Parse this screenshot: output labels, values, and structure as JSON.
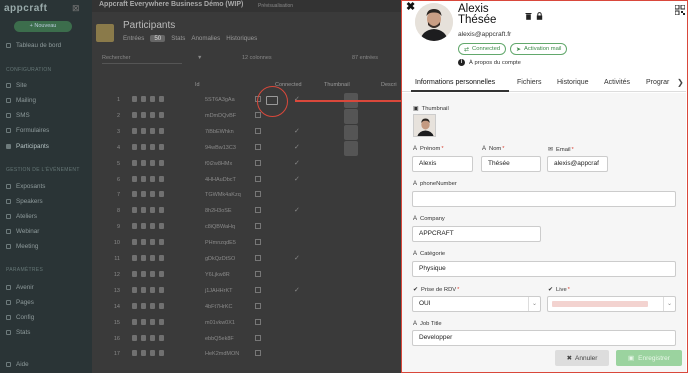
{
  "sidebar": {
    "logo": "appcraft",
    "new_button": "+ Nouveau",
    "groups": [
      "CONFIGURATION",
      "GESTION DE L'ÉVÉNEMENT",
      "PARAMÈTRES"
    ],
    "items": [
      "Tableau de bord",
      "Site",
      "Mailing",
      "SMS",
      "Formulaires",
      "Participants",
      "Exposants",
      "Speakers",
      "Ateliers",
      "Webinar",
      "Meeting",
      "Avenir",
      "Pages",
      "Config",
      "Stats",
      "Aide"
    ]
  },
  "main": {
    "app_title": "Appcraft Everywhere Business Démo (WIP)",
    "app_subtitle": "Event",
    "preview_label": "Prévisualisation",
    "page_title": "Participants",
    "tabs": [
      "Entrées",
      "Stats",
      "Anomalies",
      "Historiques"
    ],
    "entries_count": "50",
    "toolbar": {
      "search_placeholder": "Rechercher",
      "columns": "12 colonnes",
      "entries": "87 entrées"
    },
    "columns": [
      "Id",
      "Connected",
      "Thumbnail",
      "Descri"
    ],
    "rows": [
      {
        "num": "1",
        "code": "5ST6A3gAa",
        "connected": true,
        "thumb": true
      },
      {
        "num": "2",
        "code": "mDmDQvBF",
        "connected": false,
        "thumb": true
      },
      {
        "num": "3",
        "code": "7iBbEWhkn",
        "connected": true,
        "thumb": true
      },
      {
        "num": "4",
        "code": "94wBw13C3",
        "connected": true,
        "thumb": true
      },
      {
        "num": "5",
        "code": "f0i2w8HMx",
        "connected": true,
        "thumb": false
      },
      {
        "num": "6",
        "code": "4HHAuDbcT",
        "connected": true,
        "thumb": false
      },
      {
        "num": "7",
        "code": "TGWMk4aKzq",
        "connected": false,
        "thumb": false
      },
      {
        "num": "8",
        "code": "8h2H3oSE",
        "connected": true,
        "thumb": false
      },
      {
        "num": "9",
        "code": "c8iQBWaHq",
        "connected": false,
        "thumb": false
      },
      {
        "num": "10",
        "code": "PHmnzqdE5",
        "connected": false,
        "thumb": false
      },
      {
        "num": "11",
        "code": "gDkQzDtSO",
        "connected": true,
        "thumb": false
      },
      {
        "num": "12",
        "code": "Y6Ljkw8R",
        "connected": false,
        "thumb": false
      },
      {
        "num": "13",
        "code": "j1JAHHrKT",
        "connected": true,
        "thumb": false
      },
      {
        "num": "14",
        "code": "4bFt7HrKC",
        "connected": false,
        "thumb": false
      },
      {
        "num": "15",
        "code": "m01vkw0X1",
        "connected": false,
        "thumb": false
      },
      {
        "num": "16",
        "code": "ebbQ5ek8F",
        "connected": false,
        "thumb": false
      },
      {
        "num": "17",
        "code": "HeK2mdMON",
        "connected": false,
        "thumb": false
      }
    ]
  },
  "panel": {
    "name_line1": "Alexis",
    "name_line2": "Thésée",
    "email": "alexis@appcraft.fr",
    "badge_connected": "Connected",
    "badge_activation": "Activation mail",
    "about": "À propos du compte",
    "tabs": [
      "Informations personnelles",
      "Fichiers",
      "Historique",
      "Activités",
      "Prograr"
    ],
    "labels": {
      "thumbnail": "Thumbnail",
      "prenom": "Prénom",
      "nom": "Nom",
      "email": "Email",
      "phone": "phoneNumber",
      "company": "Company",
      "categorie": "Catégorie",
      "prise_rdv": "Prise de RDV",
      "live": "Live",
      "job": "Job Title"
    },
    "values": {
      "prenom": "Alexis",
      "nom": "Thésée",
      "email": "alexis@appcraf",
      "phone": "",
      "company": "APPCRAFT",
      "categorie": "Physique",
      "prise_rdv": "OUI",
      "live": "",
      "job": "Developper"
    },
    "cancel": "Annuler",
    "save": "Enregistrer"
  }
}
